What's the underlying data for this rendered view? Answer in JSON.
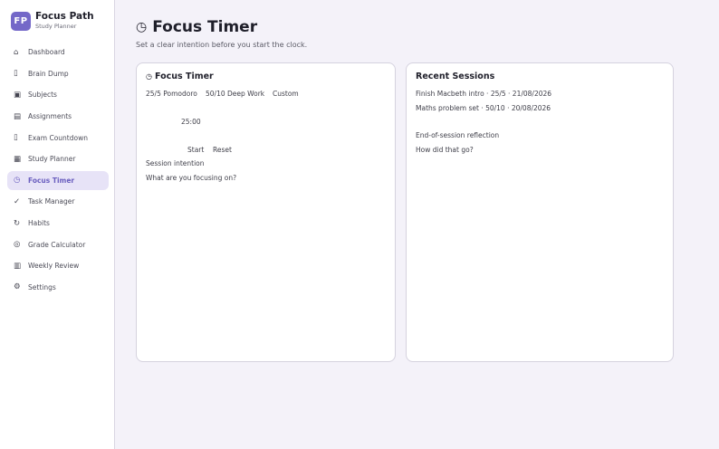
{
  "brand": {
    "logo": "FP",
    "name": "Focus Path",
    "subtitle": "Study Planner",
    "color": "#7468c8"
  },
  "sidebar": {
    "items": [
      {
        "label": "Dashboard",
        "icon": "⌂",
        "icon_name": "home-icon"
      },
      {
        "label": "Brain Dump",
        "icon": "▯",
        "icon_name": "note-icon"
      },
      {
        "label": "Subjects",
        "icon": "▣",
        "icon_name": "book-icon"
      },
      {
        "label": "Assignments",
        "icon": "▤",
        "icon_name": "list-icon"
      },
      {
        "label": "Exam Countdown",
        "icon": "▯",
        "icon_name": "hourglass-icon"
      },
      {
        "label": "Study Planner",
        "icon": "▦",
        "icon_name": "calendar-icon"
      },
      {
        "label": "Focus Timer",
        "icon": "◷",
        "icon_name": "clock-icon",
        "active": true
      },
      {
        "label": "Task Manager",
        "icon": "✓",
        "icon_name": "check-icon"
      },
      {
        "label": "Habits",
        "icon": "↻",
        "icon_name": "repeat-icon"
      },
      {
        "label": "Grade Calculator",
        "icon": "◎",
        "icon_name": "target-icon"
      },
      {
        "label": "Weekly Review",
        "icon": "▥",
        "icon_name": "chart-icon"
      },
      {
        "label": "Settings",
        "icon": "⚙",
        "icon_name": "gear-icon"
      }
    ]
  },
  "header": {
    "icon": "◷",
    "title": "Focus Timer",
    "subtitle": "Set a clear intention before you start the clock."
  },
  "timer": {
    "icon": "◷",
    "title": "Focus Timer",
    "modes": [
      "25/5 Pomodoro",
      "50/10 Deep Work",
      "Custom"
    ],
    "display": "25:00",
    "start_label": "Start",
    "reset_label": "Reset",
    "intention_label": "Session intention",
    "intention_placeholder": "What are you focusing on?"
  },
  "recent": {
    "title": "Recent Sessions",
    "sessions": [
      "Finish Macbeth intro · 25/5 · 21/08/2026",
      "Maths problem set · 50/10 · 20/08/2026"
    ],
    "reflection_label": "End-of-session reflection",
    "reflection_placeholder": "How did that go?"
  },
  "colors": {
    "accent": "#7468c8",
    "active_bg": "#e7e3f7",
    "background": "#f4f2f9"
  }
}
